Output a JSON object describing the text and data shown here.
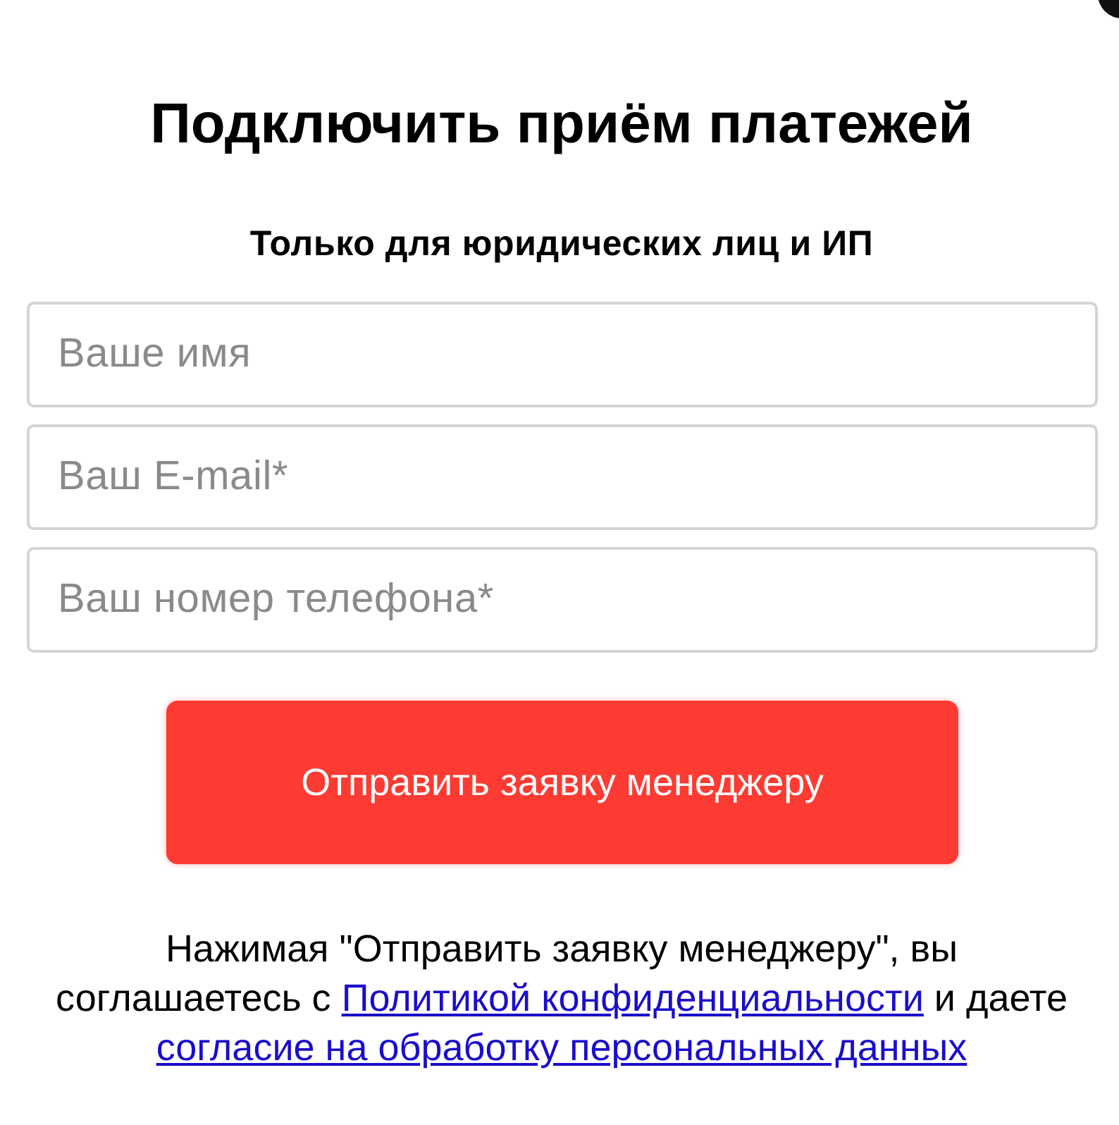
{
  "title": "Подключить приём платежей",
  "subtitle": "Только для юридических лиц и ИП",
  "fields": [
    {
      "placeholder": "Ваше имя"
    },
    {
      "placeholder": "Ваш E-mail*"
    },
    {
      "placeholder": "Ваш номер телефона*"
    }
  ],
  "submit_button": {
    "label": "Отправить заявку менеджеру"
  },
  "consent": [
    {
      "kind": "text",
      "text": "Нажимая \"Отправить заявку менеджеру\", вы соглашаетесь с "
    },
    {
      "kind": "link",
      "text": "Политикой конфиденциальности"
    },
    {
      "kind": "text",
      "text": " и даете "
    },
    {
      "kind": "link",
      "text": "согласие на обработку персональных данных"
    }
  ]
}
